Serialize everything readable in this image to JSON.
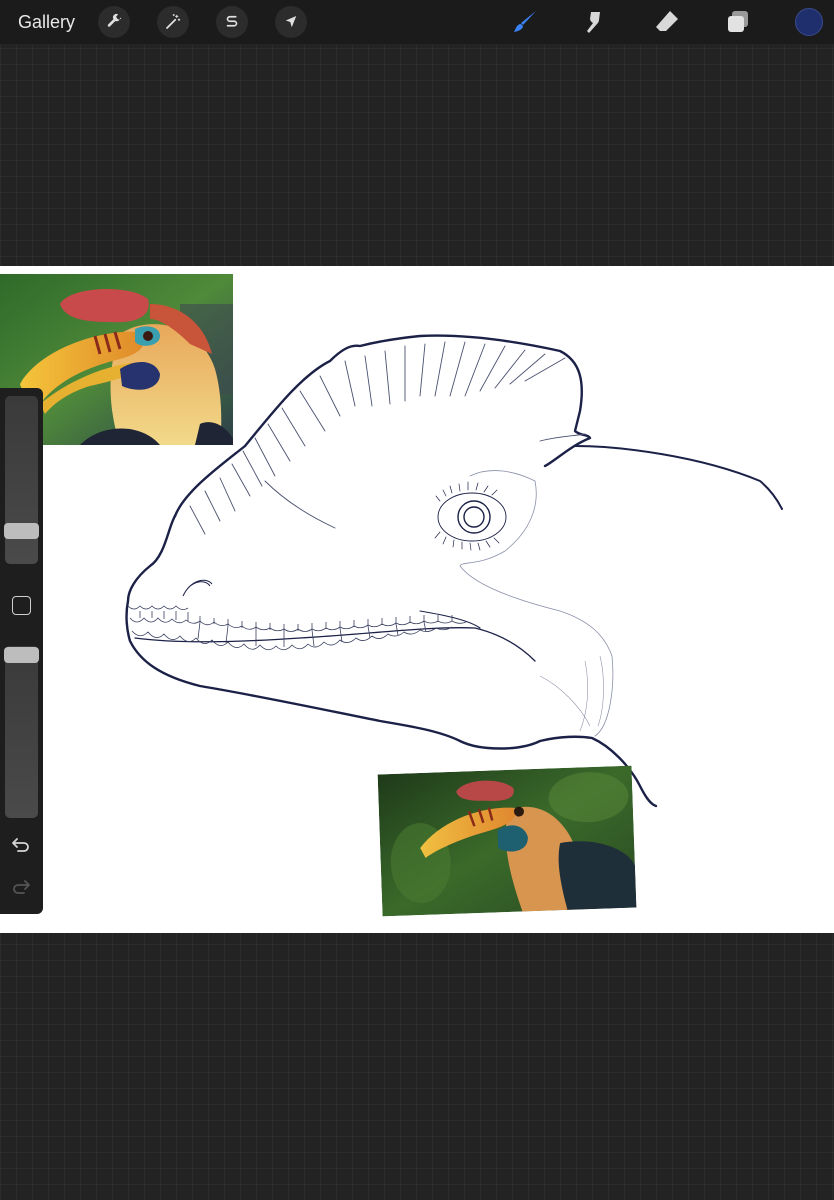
{
  "topbar": {
    "gallery_label": "Gallery",
    "left_tools": [
      {
        "name": "actions",
        "icon": "wrench-icon"
      },
      {
        "name": "adjustments",
        "icon": "magic-wand-icon"
      },
      {
        "name": "selection",
        "icon": "selection-s-icon"
      },
      {
        "name": "transform",
        "icon": "arrow-cursor-icon"
      }
    ],
    "right_tools": [
      {
        "name": "brush",
        "icon": "brush-icon",
        "active": true
      },
      {
        "name": "smudge",
        "icon": "smudge-icon"
      },
      {
        "name": "eraser",
        "icon": "eraser-icon"
      },
      {
        "name": "layers",
        "icon": "layers-icon"
      }
    ],
    "current_color": "#1f2f6e",
    "active_tool_color": "#3b82f6"
  },
  "canvas": {
    "background": "#ffffff",
    "line_color": "#1b2147",
    "reference_images": [
      "hornbill-reference-photo-1",
      "hornbill-reference-photo-2"
    ]
  },
  "sidebar": {
    "brush_size_level": 0.2,
    "opacity_level": 0.97,
    "modify_icon": "square-modify-icon",
    "undo_icon": "undo-icon",
    "redo_icon": "redo-icon"
  }
}
